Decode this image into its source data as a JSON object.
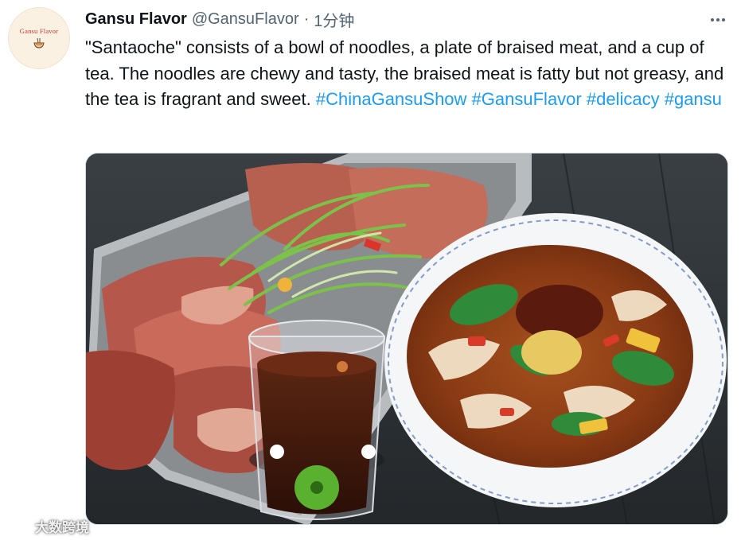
{
  "author": {
    "display_name": "Gansu Flavor",
    "handle": "@GansuFlavor",
    "separator": "·",
    "timestamp": "1分钟",
    "avatar_text": "Gansu Flavor"
  },
  "tweet": {
    "text_before_tags": "\"Santaoche\" consists of a bowl of noodles, a plate of braised meat, and a cup of tea. The noodles are chewy and tasty, the braised meat is fatty but not greasy, and the tea is fragrant and sweet.",
    "hashtags": [
      "#ChinaGansuShow",
      "#GansuFlavor",
      "#delicacy",
      "#gansu"
    ]
  },
  "watermark": {
    "text": "大数跨境",
    "icon": "watermark-logo-icon"
  },
  "icons": {
    "more": "more-options-icon",
    "avatar": "noodle-bowl-icon"
  },
  "colors": {
    "accent": "#1d9bf0",
    "text": "#0f1419",
    "muted": "#536471"
  }
}
